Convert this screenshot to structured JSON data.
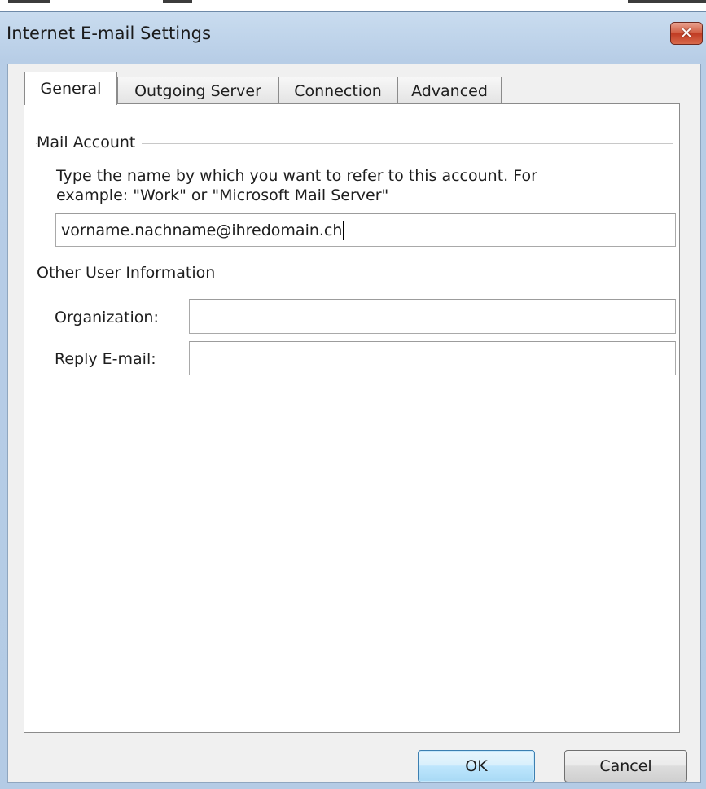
{
  "window": {
    "title": "Internet E-mail Settings",
    "close_symbol": "✕"
  },
  "tabs": [
    {
      "label": "General",
      "active": true
    },
    {
      "label": "Outgoing Server",
      "active": false
    },
    {
      "label": "Connection",
      "active": false
    },
    {
      "label": "Advanced",
      "active": false
    }
  ],
  "mail_account": {
    "group_label": "Mail Account",
    "description_line1": "Type the name by which you want to refer to this account. For",
    "description_line2": "example: \"Work\" or \"Microsoft Mail Server\"",
    "value": "vorname.nachname@ihredomain.ch"
  },
  "other_user_info": {
    "group_label": "Other User Information",
    "organization_label": "Organization:",
    "organization_value": "",
    "reply_email_label": "Reply E-mail:",
    "reply_email_value": ""
  },
  "buttons": {
    "ok": "OK",
    "cancel": "Cancel"
  },
  "icons": {
    "close": "close-icon"
  }
}
